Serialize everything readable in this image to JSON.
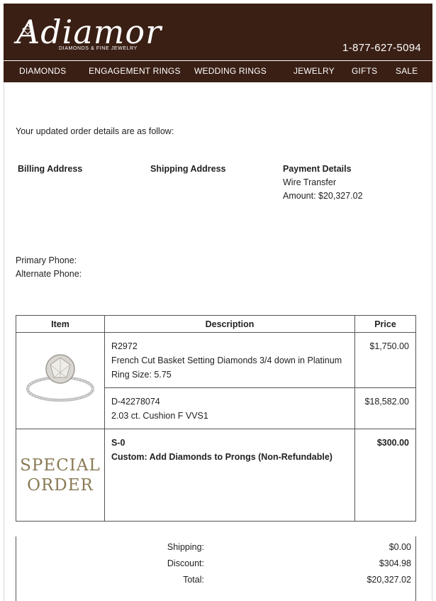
{
  "brand": {
    "name": "Adiamor",
    "tagline": "DIAMONDS & FINE JEWELRY",
    "phone": "1-877-627-5094"
  },
  "nav": [
    "DIAMONDS",
    "ENGAGEMENT RINGS",
    "WEDDING RINGS",
    "JEWELRY",
    "GIFTS",
    "SALE"
  ],
  "intro": "Your updated order details are as follow:",
  "billing": {
    "heading": "Billing Address"
  },
  "shipping": {
    "heading": "Shipping Address"
  },
  "payment": {
    "heading": "Payment Details",
    "method": "Wire Transfer",
    "amount": "Amount: $20,327.02"
  },
  "phones": {
    "primary": "Primary Phone:",
    "alternate": "Alternate Phone:"
  },
  "table": {
    "headers": [
      "Item",
      "Description",
      "Price"
    ],
    "rows": [
      {
        "sku": "R2972",
        "desc": "French Cut Basket Setting Diamonds 3/4 down in Platinum",
        "extra": "Ring Size: 5.75",
        "price": "$1,750.00"
      },
      {
        "sku": "D-42278074",
        "desc": "2.03 ct. Cushion F VVS1",
        "price": "$18,582.00"
      },
      {
        "sku": "S-0",
        "desc": "Custom: Add Diamonds to Prongs (Non-Refundable)",
        "price": "$300.00",
        "image_text": [
          "SPECIAL",
          "ORDER"
        ]
      }
    ]
  },
  "totals": {
    "shipping_label": "Shipping:",
    "shipping": "$0.00",
    "discount_label": "Discount:",
    "discount": "$304.98",
    "total_label": "Total:",
    "total": "$20,327.02"
  },
  "colors": {
    "header_bg": "#3a1f14",
    "special_text": "#8a7a55"
  }
}
